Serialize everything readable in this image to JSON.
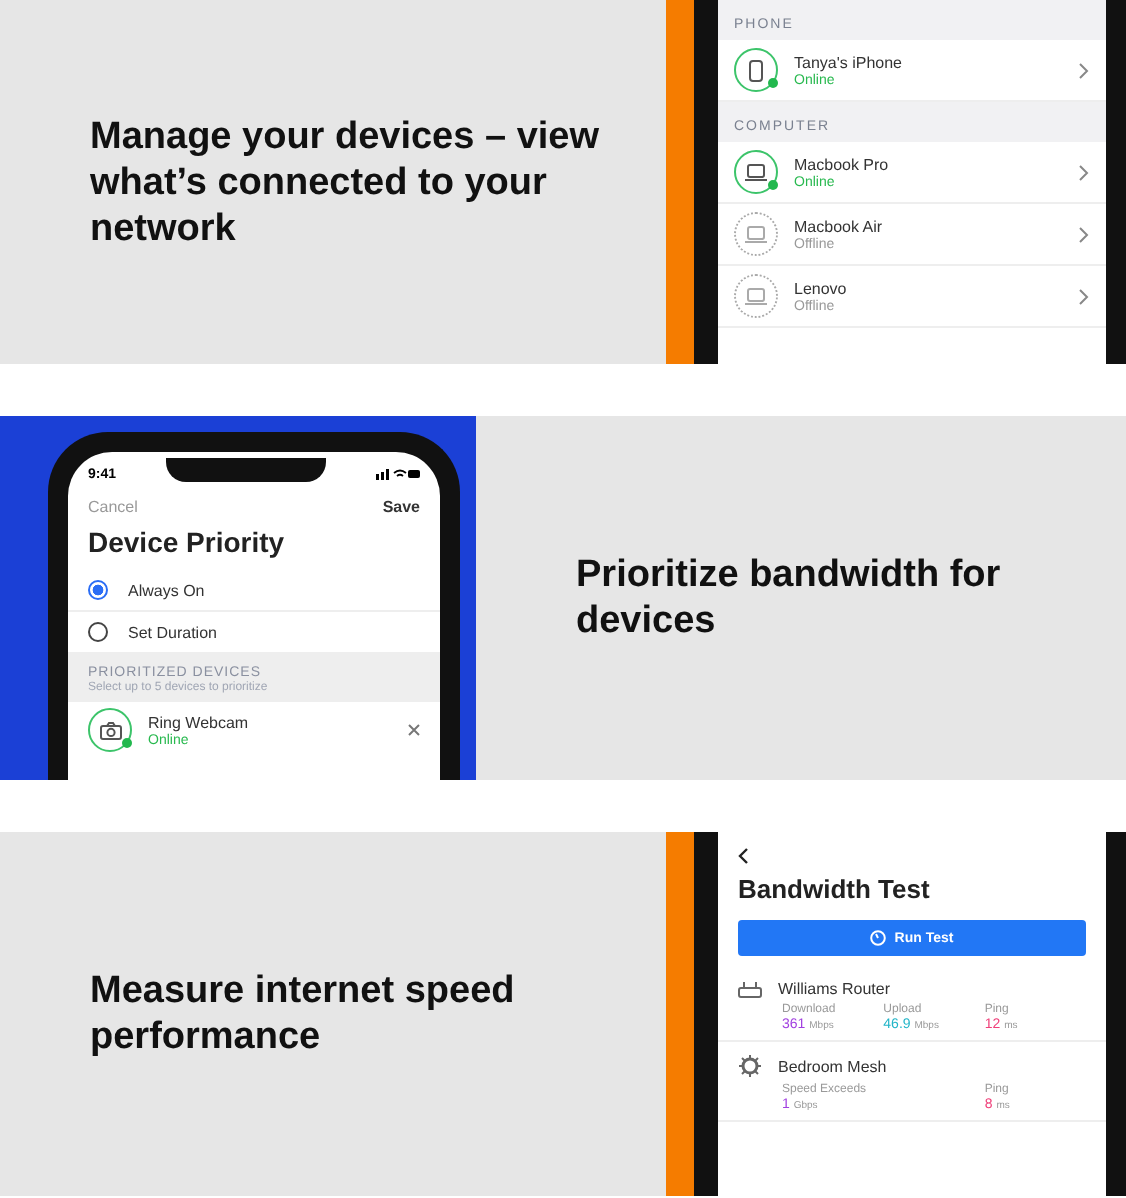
{
  "panels": [
    {
      "kind": "device-list",
      "caption": "Manage your devices – view what’s connected to your network",
      "sections": [
        {
          "title": "PHONE",
          "devices": [
            {
              "name": "Tanya's iPhone",
              "status": "Online",
              "online": true,
              "kind": "phone"
            }
          ]
        },
        {
          "title": "COMPUTER",
          "devices": [
            {
              "name": "Macbook Pro",
              "status": "Online",
              "online": true,
              "kind": "laptop"
            },
            {
              "name": "Macbook Air",
              "status": "Offline",
              "online": false,
              "kind": "laptop"
            },
            {
              "name": "Lenovo",
              "status": "Offline",
              "online": false,
              "kind": "laptop"
            }
          ]
        }
      ]
    },
    {
      "kind": "priority",
      "caption": "Prioritize bandwidth for devices",
      "time": "9:41",
      "cancel": "Cancel",
      "save": "Save",
      "title": "Device Priority",
      "options": [
        {
          "label": "Always On",
          "selected": true
        },
        {
          "label": "Set Duration",
          "selected": false
        }
      ],
      "section_title": "PRIORITIZED DEVICES",
      "section_hint": "Select up to 5 devices to prioritize",
      "device": {
        "name": "Ring Webcam",
        "status": "Online",
        "online": true
      }
    },
    {
      "kind": "speed",
      "caption": "Measure internet speed performance",
      "title": "Bandwidth Test",
      "button": "Run Test",
      "devices": [
        {
          "name": "Williams Router",
          "kind": "router",
          "metrics": [
            {
              "label": "Download",
              "value": "361",
              "unit": "Mbps",
              "color": "#a13fe0"
            },
            {
              "label": "Upload",
              "value": "46.9",
              "unit": "Mbps",
              "color": "#22b5c8"
            },
            {
              "label": "Ping",
              "value": "12",
              "unit": "ms",
              "color": "#f0407a"
            }
          ]
        },
        {
          "name": "Bedroom Mesh",
          "kind": "mesh",
          "metrics": [
            {
              "label": "Speed Exceeds",
              "value": "1",
              "unit": "Gbps",
              "color": "#a13fe0"
            },
            {
              "label": "Ping",
              "value": "8",
              "unit": "ms",
              "color": "#f0407a"
            }
          ]
        }
      ]
    }
  ]
}
